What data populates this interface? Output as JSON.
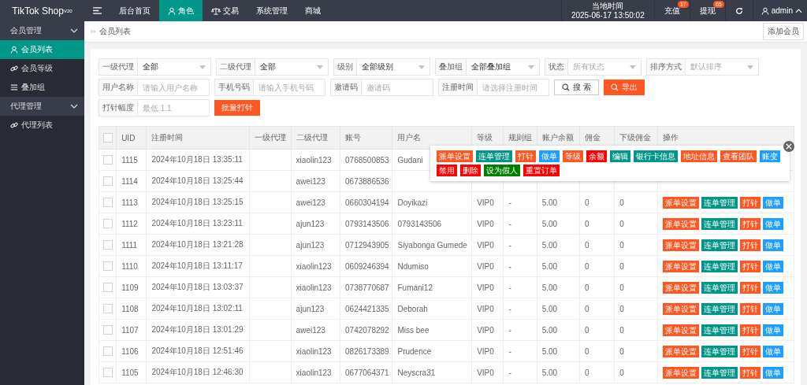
{
  "topbar": {
    "logo": "TikTok Shop$^{V20}$",
    "nav": [
      {
        "label": "后台首页",
        "selected": false
      },
      {
        "label": "角色",
        "selected": true
      },
      {
        "label": "交易",
        "selected": false
      },
      {
        "label": "系统管理",
        "selected": false
      },
      {
        "label": "商城",
        "selected": false
      }
    ],
    "clock": {
      "label": "当地时间",
      "time": "2025-06-17 13:50:02"
    },
    "actions": [
      {
        "label": "充值",
        "badge": "17"
      },
      {
        "label": "提现",
        "badge": "65"
      }
    ],
    "user": "admin"
  },
  "sidebar": {
    "groups": [
      {
        "label": "会员管理",
        "expanded": true,
        "children": [
          {
            "label": "会员列表",
            "selected": true
          },
          {
            "label": "会员等级",
            "selected": false
          },
          {
            "label": "叠加组",
            "selected": false
          }
        ]
      },
      {
        "label": "代理管理",
        "expanded": true,
        "children": [
          {
            "label": "代理列表",
            "selected": false
          }
        ]
      }
    ]
  },
  "breadcrumb": "会员列表",
  "add_button": "添加会员",
  "filter_rows": [
    {
      "items": [
        {
          "kind": "select",
          "label": "一级代理",
          "value": "全部"
        },
        {
          "kind": "select",
          "label": "二级代理",
          "value": "全部"
        },
        {
          "kind": "select",
          "label": "级别",
          "value": "全部级别"
        },
        {
          "kind": "select",
          "label": "叠加组",
          "value": "全部叠加组"
        },
        {
          "kind": "select",
          "label": "状态",
          "placeholder": "所有状态"
        },
        {
          "kind": "select",
          "label": "排序方式",
          "placeholder": "默认排序"
        }
      ]
    },
    {
      "items": [
        {
          "kind": "input",
          "label": "用户名称",
          "placeholder": "请输入用户名称"
        },
        {
          "kind": "input",
          "label": "手机号码",
          "placeholder": "请输入手机号码"
        },
        {
          "kind": "input",
          "label": "邀请码",
          "placeholder": "邀请码"
        },
        {
          "kind": "input",
          "label": "注册时间",
          "placeholder": "请选择注册时间"
        },
        {
          "kind": "search",
          "label": "搜 索"
        },
        {
          "kind": "export",
          "label": "导出"
        }
      ]
    },
    {
      "items": [
        {
          "kind": "input",
          "label": "打针幅度",
          "placeholder": "最低 1.1"
        },
        {
          "kind": "batch",
          "label": "批量打针"
        }
      ]
    }
  ],
  "table": {
    "all_checked": false,
    "columns": [
      "UID",
      "注册时间",
      "一级代理",
      "二级代理",
      "账号",
      "用户名",
      "等级",
      "规则组",
      "账户余额",
      "佣金",
      "下级佣金",
      "操作"
    ],
    "rows": [
      {
        "checked": false,
        "uid": "1115",
        "registered": "2024年10月18日 13:35:11",
        "agent_2": "xiaolin123",
        "account": "0768500853",
        "username": "Gudani"
      },
      {
        "checked": false,
        "uid": "1114",
        "registered": "2024年10月18日 13:25:44",
        "agent_2": "awei123",
        "account": "0673886536"
      },
      {
        "checked": false,
        "uid": "1113",
        "registered": "2024年10月18日 13:25:15",
        "agent_2": "awei123",
        "account": "0660304194",
        "username": "Doyikazi",
        "level": "VIP0",
        "rule_group": "-",
        "balance": "5.00",
        "commission": "0",
        "sub_commission": "0",
        "actions": [
          {
            "label": "派单设置",
            "color": "#ff5722"
          },
          {
            "label": "连单管理",
            "color": "#009688"
          },
          {
            "label": "打针",
            "color": "#ff5722"
          },
          {
            "label": "做单",
            "color": "#1e9fff"
          }
        ]
      },
      {
        "checked": false,
        "uid": "1112",
        "registered": "2024年10月18日 13:23:11",
        "agent_2": "ajun123",
        "account": "0793143506",
        "username": "0793143506",
        "level": "VIP0",
        "rule_group": "-",
        "balance": "5.00",
        "commission": "0",
        "sub_commission": "0",
        "actions": [
          {
            "label": "派单设置",
            "color": "#ff5722"
          },
          {
            "label": "连单管理",
            "color": "#009688"
          },
          {
            "label": "打针",
            "color": "#ff5722"
          },
          {
            "label": "做单",
            "color": "#1e9fff"
          }
        ]
      },
      {
        "checked": false,
        "uid": "1111",
        "registered": "2024年10月18日 13:21:28",
        "agent_2": "ajun123",
        "account": "0712943905",
        "username": "Siyabonga Gumede",
        "level": "VIP0",
        "rule_group": "-",
        "balance": "5.00",
        "commission": "0",
        "sub_commission": "0",
        "actions": [
          {
            "label": "派单设置",
            "color": "#ff5722"
          },
          {
            "label": "连单管理",
            "color": "#009688"
          },
          {
            "label": "打针",
            "color": "#ff5722"
          },
          {
            "label": "做单",
            "color": "#1e9fff"
          }
        ]
      },
      {
        "checked": false,
        "uid": "1110",
        "registered": "2024年10月18日 13:11:17",
        "agent_2": "xiaolin123",
        "account": "0609246394",
        "username": "Ndumiso",
        "level": "VIP0",
        "rule_group": "-",
        "balance": "5.00",
        "commission": "0",
        "sub_commission": "0",
        "actions": [
          {
            "label": "派单设置",
            "color": "#ff5722"
          },
          {
            "label": "连单管理",
            "color": "#009688"
          },
          {
            "label": "打针",
            "color": "#ff5722"
          },
          {
            "label": "做单",
            "color": "#1e9fff"
          }
        ]
      },
      {
        "checked": false,
        "uid": "1109",
        "registered": "2024年10月18日 13:03:37",
        "agent_2": "xiaolin123",
        "account": "0738770687",
        "username": "Fumani12",
        "level": "VIP0",
        "rule_group": "-",
        "balance": "5.00",
        "commission": "0",
        "sub_commission": "0",
        "actions": [
          {
            "label": "派单设置",
            "color": "#ff5722"
          },
          {
            "label": "连单管理",
            "color": "#009688"
          },
          {
            "label": "打针",
            "color": "#ff5722"
          },
          {
            "label": "做单",
            "color": "#1e9fff"
          }
        ]
      },
      {
        "checked": false,
        "uid": "1108",
        "registered": "2024年10月18日 13:02:11",
        "agent_2": "ajun123",
        "account": "0624421335",
        "username": "Deborah",
        "level": "VIP0",
        "rule_group": "-",
        "balance": "5.00",
        "commission": "0",
        "sub_commission": "0",
        "actions": [
          {
            "label": "派单设置",
            "color": "#ff5722"
          },
          {
            "label": "连单管理",
            "color": "#009688"
          },
          {
            "label": "打针",
            "color": "#ff5722"
          },
          {
            "label": "做单",
            "color": "#1e9fff"
          }
        ]
      },
      {
        "checked": false,
        "uid": "1107",
        "registered": "2024年10月18日 13:01:29",
        "agent_2": "awei123",
        "account": "0742078292",
        "username": "Miss bee",
        "level": "VIP0",
        "rule_group": "-",
        "balance": "5.00",
        "commission": "0",
        "sub_commission": "0",
        "actions": [
          {
            "label": "派单设置",
            "color": "#ff5722"
          },
          {
            "label": "连单管理",
            "color": "#009688"
          },
          {
            "label": "打针",
            "color": "#ff5722"
          },
          {
            "label": "做单",
            "color": "#1e9fff"
          }
        ]
      },
      {
        "checked": false,
        "uid": "1106",
        "registered": "2024年10月18日 12:51:46",
        "agent_2": "xiaolin123",
        "account": "0826173389",
        "username": "Prudence",
        "level": "VIP0",
        "rule_group": "-",
        "balance": "5.00",
        "commission": "0",
        "sub_commission": "0",
        "actions": [
          {
            "label": "派单设置",
            "color": "#ff5722"
          },
          {
            "label": "连单管理",
            "color": "#009688"
          },
          {
            "label": "打针",
            "color": "#ff5722"
          },
          {
            "label": "做单",
            "color": "#1e9fff"
          }
        ]
      },
      {
        "checked": false,
        "uid": "1105",
        "registered": "2024年10月18日 12:46:30",
        "agent_2": "xiaolin123",
        "account": "0677064371",
        "username": "Neyscra31",
        "level": "VIP0",
        "rule_group": "-",
        "balance": "5.00",
        "commission": "0",
        "sub_commission": "0",
        "actions": [
          {
            "label": "派单设置",
            "color": "#ff5722"
          },
          {
            "label": "连单管理",
            "color": "#009688"
          },
          {
            "label": "打针",
            "color": "#ff5722"
          },
          {
            "label": "做单",
            "color": "#1e9fff"
          }
        ]
      }
    ]
  },
  "action_popup": {
    "buttons": [
      {
        "label": "派单设置",
        "color": "#ff5722"
      },
      {
        "label": "连单管理",
        "color": "#009688"
      },
      {
        "label": "打针",
        "color": "#ff5722"
      },
      {
        "label": "做单",
        "color": "#1e9fff"
      },
      {
        "label": "等级",
        "color": "#ff5722"
      },
      {
        "label": "余额",
        "color": "#ff0000"
      },
      {
        "label": "编辑",
        "color": "#009688"
      },
      {
        "label": "银行卡信息",
        "color": "#009688"
      },
      {
        "label": "地址信息",
        "color": "#ff5722"
      },
      {
        "label": "查看团队",
        "color": "#ff5722"
      },
      {
        "label": "账变",
        "color": "#1e9fff"
      },
      {
        "label": "禁用",
        "color": "#ff0000"
      },
      {
        "label": "删除",
        "color": "#ff0000"
      },
      {
        "label": "设为假人",
        "color": "#008000"
      },
      {
        "label": "重置订单",
        "color": "#ff0000"
      }
    ]
  }
}
